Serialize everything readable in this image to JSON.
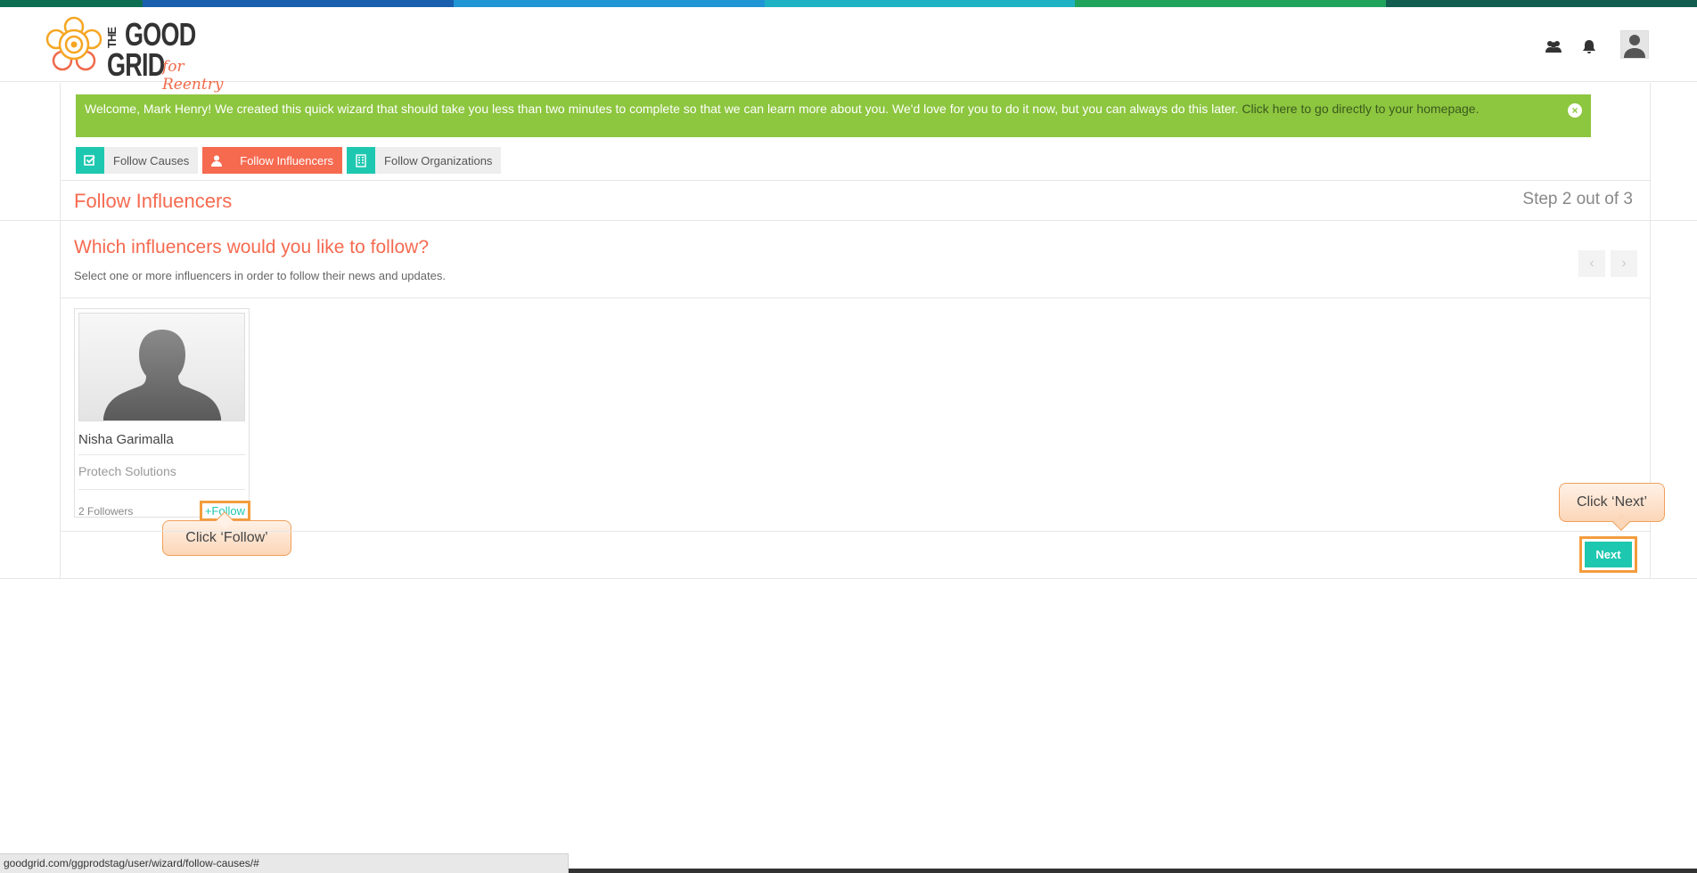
{
  "colors": {
    "topbar": [
      "#0d6e52",
      "#1a5fae",
      "#2196d4",
      "#1fb2c4",
      "#20a35c",
      "#135c50"
    ],
    "accent_teal": "#1ec8b0",
    "accent_coral": "#f66a50",
    "welcome_green": "#8dc63f",
    "highlight_orange": "#f39c3d"
  },
  "logo": {
    "the": "THE",
    "good": "GOOD",
    "grid": "GRID",
    "tagline": "for Reentry"
  },
  "header": {
    "icons": [
      "users-icon",
      "bell-icon",
      "user-avatar"
    ]
  },
  "welcome": {
    "message": "Welcome, Mark Henry! We created this quick wizard that should take you less than two minutes to complete so that we can learn more about you. We'd love for you to do it now, but you can always do this later.",
    "link": "Click here to go directly to your homepage.",
    "close_icon": "close-icon"
  },
  "steps": [
    {
      "label": "Follow Causes",
      "icon": "check-square-icon",
      "state": "done"
    },
    {
      "label": "Follow Influencers",
      "icon": "user-icon",
      "state": "active"
    },
    {
      "label": "Follow Organizations",
      "icon": "building-icon",
      "state": "todo"
    }
  ],
  "section": {
    "title": "Follow Influencers",
    "step_count": "Step 2 out of 3"
  },
  "question": {
    "title": "Which influencers would you like to follow?",
    "subtitle": "Select one or more influencers in order to follow their news and updates."
  },
  "carousel": {
    "prev_icon": "chevron-left-icon",
    "next_icon": "chevron-right-icon"
  },
  "influencer": {
    "name": "Nisha Garimalla",
    "org": "Protech Solutions",
    "followers": "2 Followers",
    "follow_label": "+Follow"
  },
  "callouts": {
    "follow": "Click ‘Follow’",
    "next": "Click ‘Next’"
  },
  "footer": {
    "next_label": "Next"
  },
  "status_url": "goodgrid.com/ggprodstag/user/wizard/follow-causes/#"
}
